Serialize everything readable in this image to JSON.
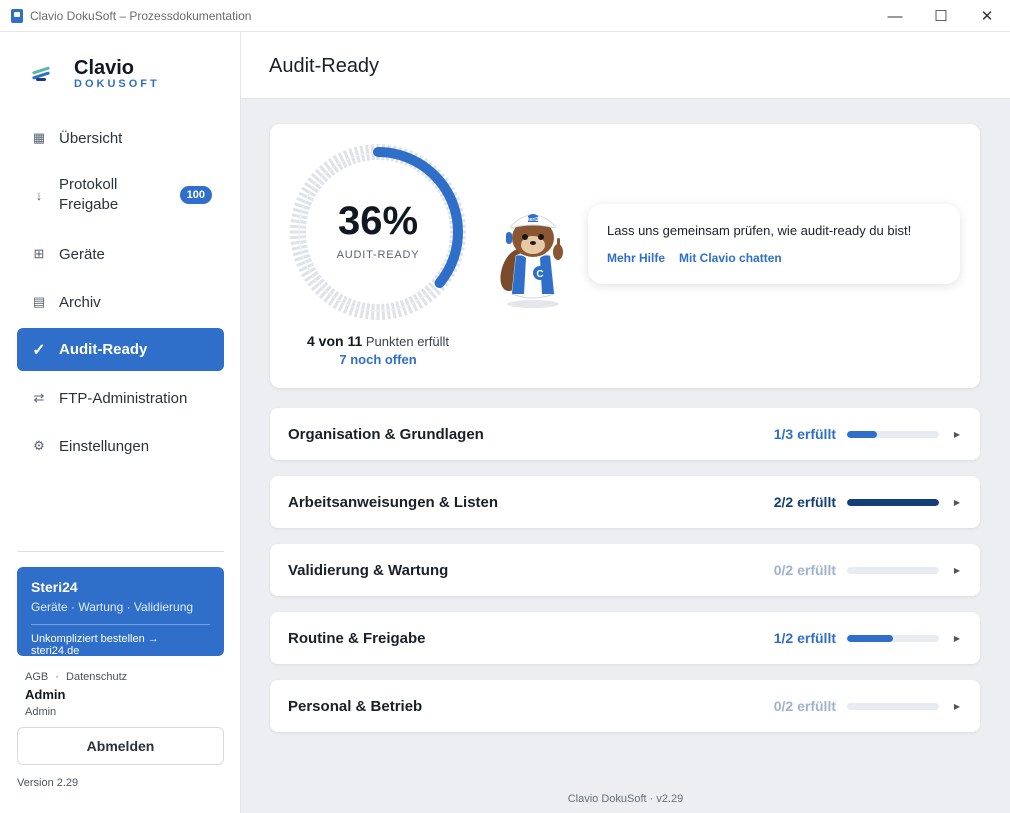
{
  "window": {
    "title": "Clavio DokuSoft – Prozessdokumentation",
    "minimize": "—",
    "maximize": "☐",
    "close": "✕"
  },
  "brand": {
    "name": "Clavio",
    "sub": "DOKUSOFT"
  },
  "nav": {
    "items": [
      {
        "label": "Übersicht",
        "icon": "grid-icon",
        "glyph": "▦"
      },
      {
        "label_line1": "Protokoll",
        "label_line2": "Freigabe",
        "icon": "download-icon",
        "glyph": "↓",
        "badge": "100"
      },
      {
        "label": "Geräte",
        "icon": "devices-icon",
        "glyph": "⊞"
      },
      {
        "label": "Archiv",
        "icon": "archive-icon",
        "glyph": "▤"
      },
      {
        "label": "Audit-Ready",
        "icon": "check-icon",
        "glyph": "✓"
      },
      {
        "label": "FTP-Administration",
        "icon": "transfer-icon",
        "glyph": "⇄"
      },
      {
        "label": "Einstellungen",
        "icon": "gear-icon",
        "glyph": "⚙"
      }
    ]
  },
  "promo": {
    "title": "Steri24",
    "subtitle": "Geräte · Wartung · Validierung",
    "link": "Unkompliziert bestellen → steri24.de"
  },
  "footer": {
    "agb": "AGB",
    "sep": "·",
    "datenschutz": "Datenschutz",
    "user_name": "Admin",
    "user_role": "Admin",
    "logout": "Abmelden",
    "version": "Version 2.29"
  },
  "main": {
    "page_title": "Audit-Ready",
    "progress": {
      "percent_label": "36%",
      "fraction": 0.36,
      "caption": "AUDIT-READY",
      "fulfilled": "4 von 11",
      "fulfilled_suffix": "Punkten erfüllt",
      "open": "7 noch offen"
    },
    "bubble": {
      "text": "Lass uns gemeinsam prüfen, wie audit-ready du bist!",
      "link1": "Mehr Hilfe",
      "link2": "Mit Clavio chatten"
    },
    "mascot": {
      "cap_text": "Steri24",
      "badge_letter": "C"
    },
    "sections": [
      {
        "title": "Organisation & Grundlagen",
        "status": "1/3 erfüllt",
        "fraction": 0.33,
        "color": "#2f6fc9"
      },
      {
        "title": "Arbeitsanweisungen & Listen",
        "status": "2/2 erfüllt",
        "fraction": 1.0,
        "color": "#143e7a"
      },
      {
        "title": "Validierung & Wartung",
        "status": "0/2 erfüllt",
        "fraction": 0.0,
        "color": "#9fb3cf"
      },
      {
        "title": "Routine & Freigabe",
        "status": "1/2 erfüllt",
        "fraction": 0.5,
        "color": "#2f6fc9"
      },
      {
        "title": "Personal & Betrieb",
        "status": "0/2 erfüllt",
        "fraction": 0.0,
        "color": "#9fb3cf"
      }
    ],
    "footer": "Clavio DokuSoft · v2.29"
  }
}
